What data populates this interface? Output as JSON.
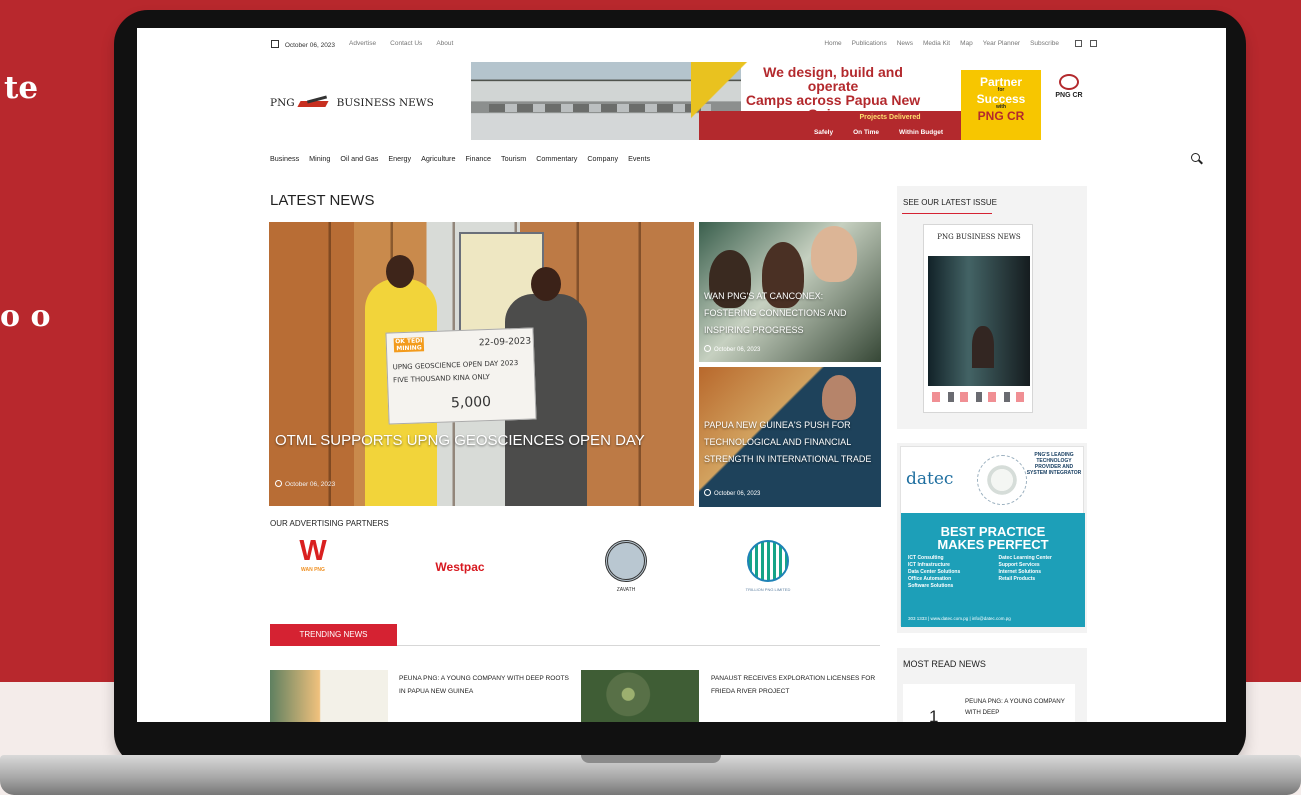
{
  "page": {
    "background_text_fragments": [
      "te",
      "o\no"
    ],
    "colors": {
      "red": "#b8282d",
      "background_light": "#f4ecea",
      "accent": "#d52232"
    }
  },
  "site": {
    "date": "October 06, 2023",
    "top_left_links": [
      "Advertise",
      "Contact Us",
      "About"
    ],
    "top_right_links": [
      "Home",
      "Publications",
      "News",
      "Media Kit",
      "Map",
      "Year Planner",
      "Subscribe"
    ],
    "logo_left": "PNG",
    "logo_right": "BUSINESS NEWS",
    "utility_icons": [
      "grid-icon",
      "menu-icon"
    ],
    "main_nav": [
      "Business",
      "Mining",
      "Oil and Gas",
      "Energy",
      "Agriculture",
      "Finance",
      "Tourism",
      "Commentary",
      "Company",
      "Events"
    ]
  },
  "banner": {
    "title_line1": "We design, build and operate",
    "title_line2": "Camps across Papua New Guinea.",
    "projects_label": "Projects Delivered",
    "project_items": [
      "Safely",
      "On Time",
      "Within Budget"
    ],
    "partner_line1": "Partner",
    "partner_small_1": "for",
    "partner_line2": "Success",
    "partner_small_2": "with",
    "partner_line3": "PNG CR",
    "corner_logo": "PNG CR"
  },
  "latest_news": {
    "title": "LATEST NEWS",
    "main": {
      "title": "OTML SUPPORTS UPNG GEOSCIENCES OPEN DAY",
      "date": "October 06, 2023",
      "cheque_logo": "OK TEDI MINING",
      "cheque_date": "22-09-2023",
      "cheque_line1": "UPNG GEOSCIENCE OPEN DAY 2023",
      "cheque_line2": "FIVE THOUSAND KINA ONLY",
      "cheque_amount": "5,000"
    },
    "side": [
      {
        "title": "WAN PNG'S AT CANCONEX: FOSTERING CONNECTIONS AND INSPIRING PROGRESS",
        "date": "October 06, 2023"
      },
      {
        "title": "PAPUA NEW GUINEA'S PUSH FOR TECHNOLOGICAL AND FINANCIAL STRENGTH IN INTERNATIONAL TRADE",
        "date": "October 06, 2023"
      }
    ]
  },
  "advertising": {
    "title": "OUR ADVERTISING PARTNERS",
    "partners": [
      {
        "name": "WAN PNG",
        "mark": "W"
      },
      {
        "name": "Westpac",
        "mark": "W"
      },
      {
        "name": "ZAVATH"
      },
      {
        "name": "TRILLION PNG LIMITED"
      }
    ]
  },
  "trending": {
    "title": "TRENDING NEWS",
    "items": [
      {
        "title": "PEUNA PNG: A YOUNG COMPANY WITH DEEP ROOTS IN PAPUA NEW GUINEA"
      },
      {
        "title": "PANAUST RECEIVES EXPLORATION LICENSES FOR FRIEDA RIVER PROJECT"
      }
    ]
  },
  "sidebar": {
    "issue_title": "SEE OUR LATEST ISSUE",
    "magazine_header": "PNG BUSINESS NEWS",
    "ad": {
      "logo": "datec",
      "right_text": "PNG'S LEADING TECHNOLOGY PROVIDER AND SYSTEM INTEGRATOR",
      "headline_line1": "BEST PRACTICE",
      "headline_line2": "MAKES PERFECT",
      "services": [
        "ICT Consulting",
        "Datec Learning Center",
        "ICT Infrastructure",
        "Support Services",
        "Data Center Solutions",
        "Internet Solutions",
        "Office Automation",
        "Retail Products",
        "Software Solutions",
        ""
      ],
      "footer": "303 1333 | www.datec.com.pg | info@datec.com.pg"
    },
    "most_read_title": "MOST READ NEWS",
    "most_read_number": "1",
    "most_read_item": "PEUNA PNG: A YOUNG COMPANY WITH DEEP"
  }
}
